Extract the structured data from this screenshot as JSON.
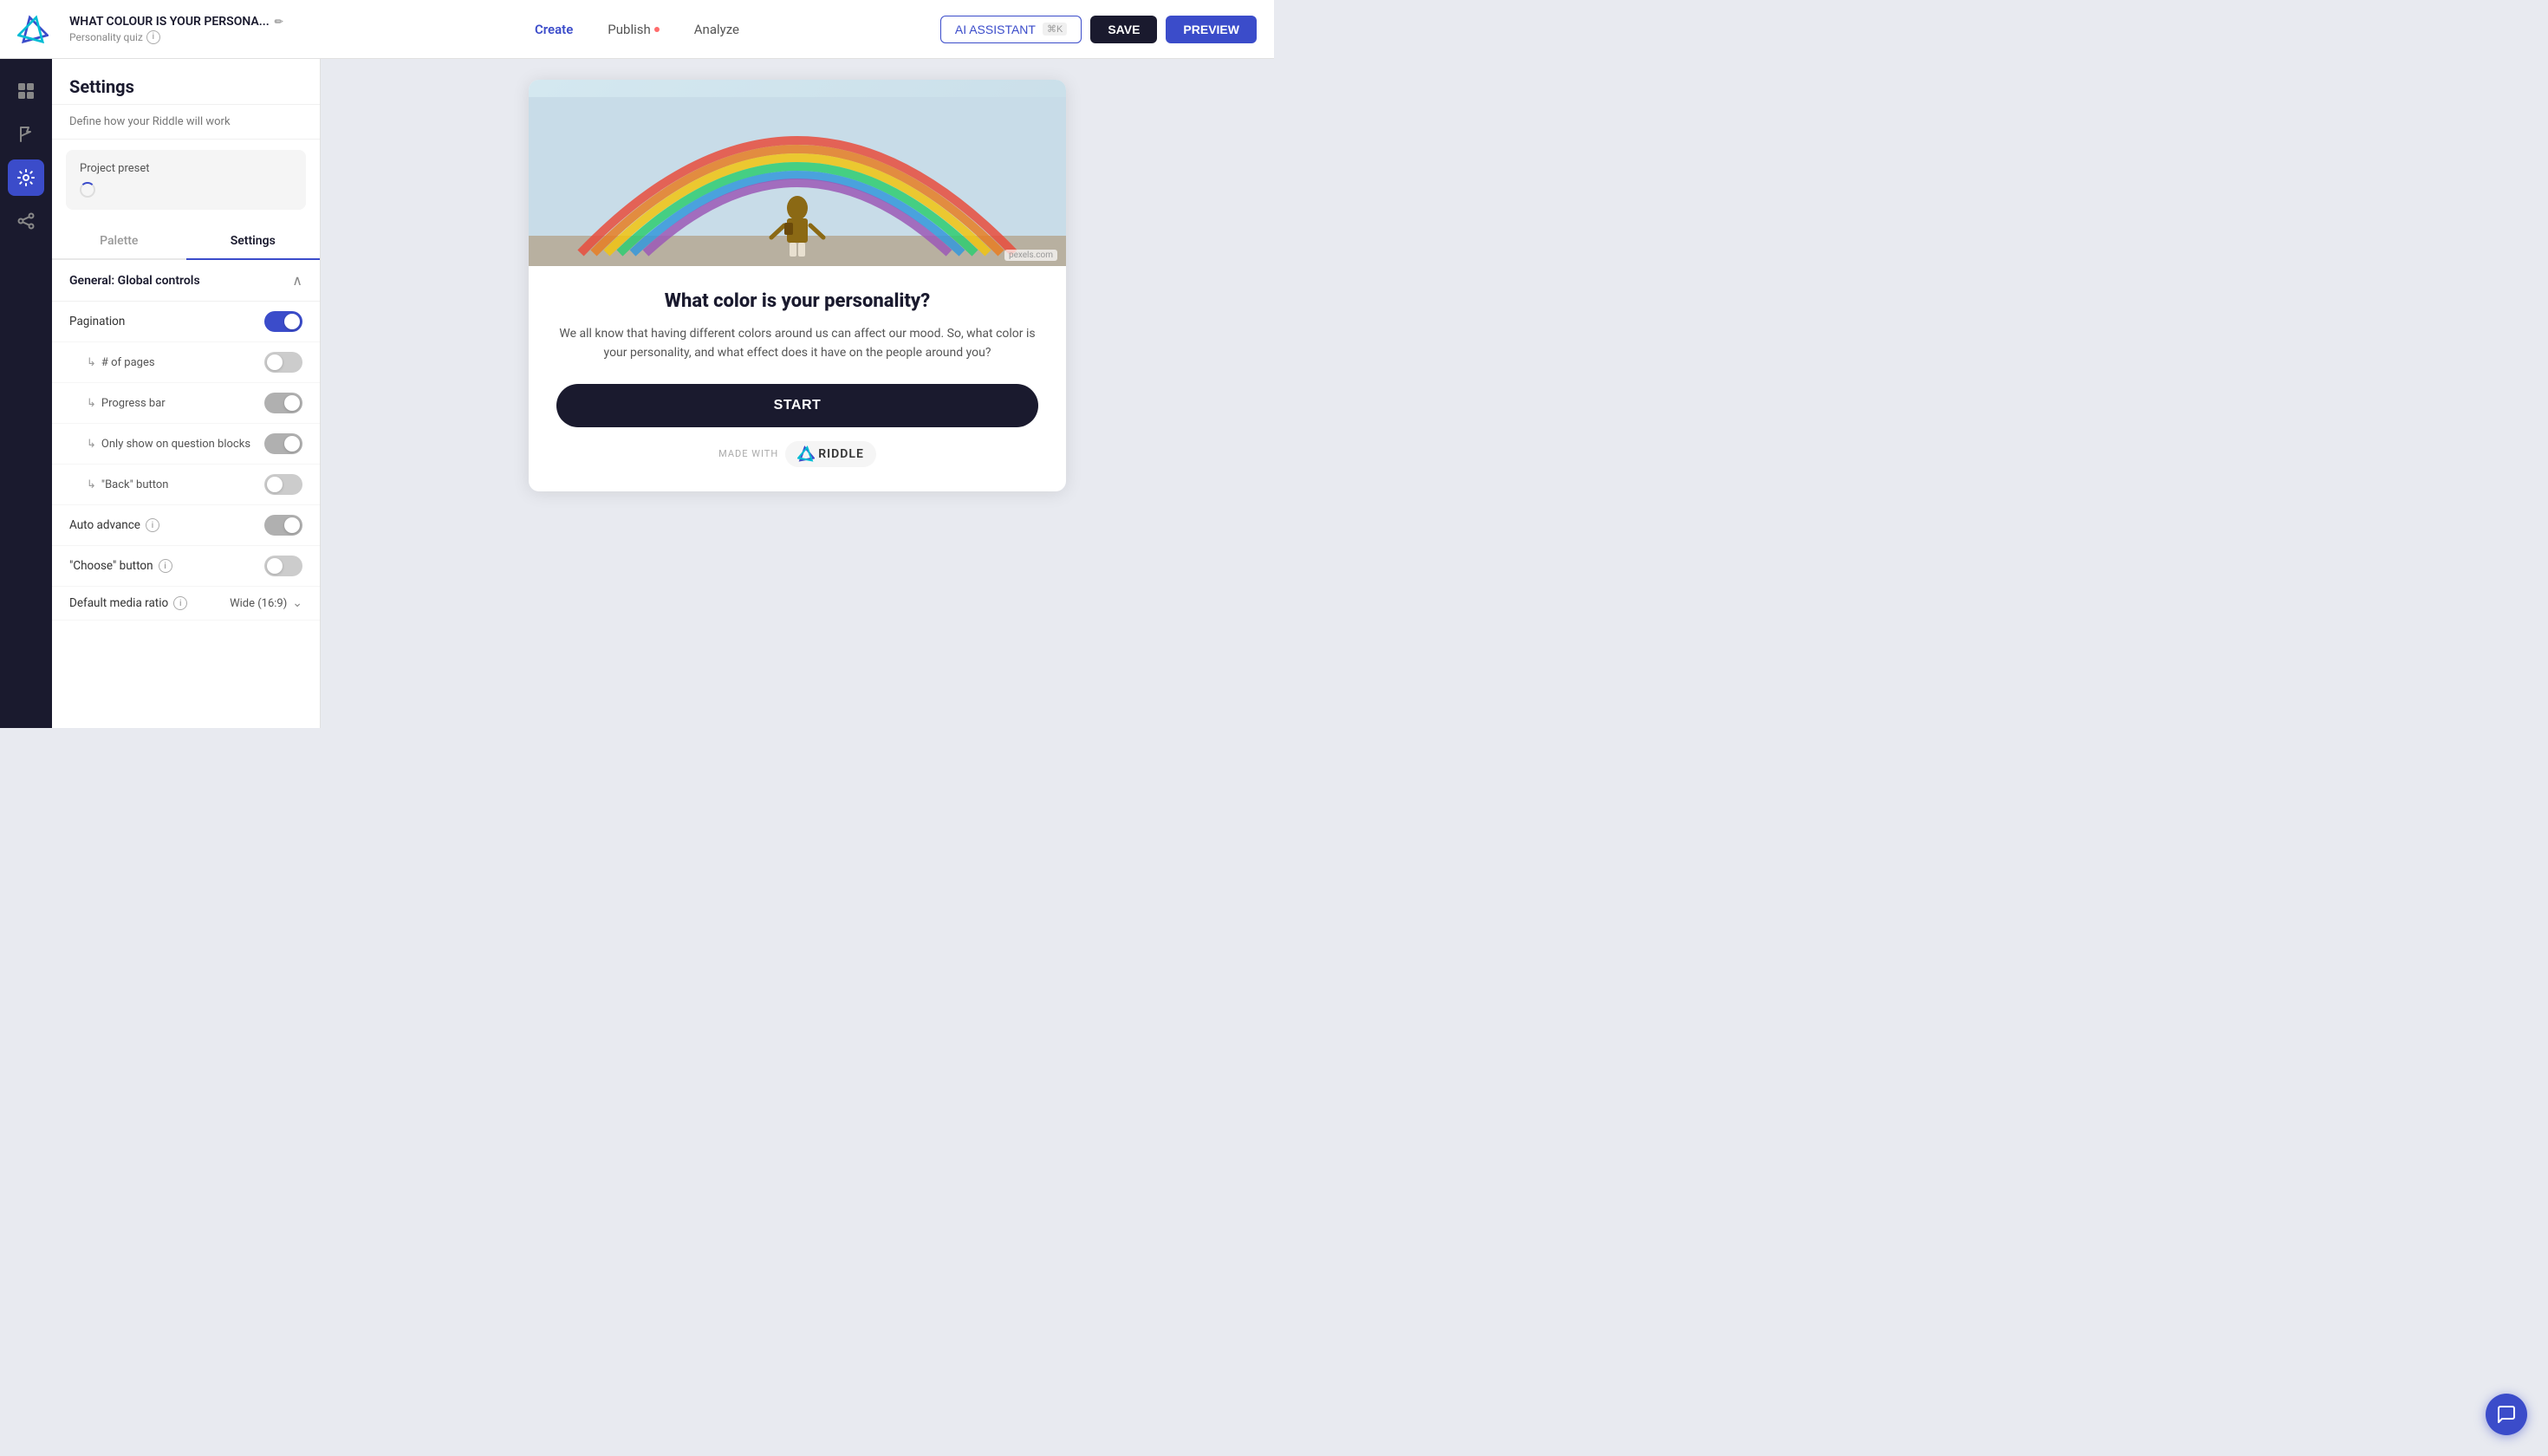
{
  "topnav": {
    "title": "WHAT COLOUR IS YOUR PERSONA...",
    "subtitle": "Personality quiz",
    "nav_create": "Create",
    "nav_publish": "Publish",
    "nav_publish_dot": true,
    "nav_analyze": "Analyze",
    "btn_ai": "AI ASSISTANT",
    "btn_ai_kbd": "⌘K",
    "btn_save": "SAVE",
    "btn_preview": "PREVIEW"
  },
  "settings": {
    "title": "Settings",
    "description": "Define how your Riddle will work",
    "project_preset_label": "Project preset",
    "tab_palette": "Palette",
    "tab_settings": "Settings",
    "section_global": "General: Global controls",
    "pagination_label": "Pagination",
    "pages_label": "# of pages",
    "progress_label": "Progress bar",
    "only_questions_label": "Only show on question blocks",
    "back_button_label": "\"Back\" button",
    "auto_advance_label": "Auto advance",
    "choose_button_label": "\"Choose\" button",
    "default_media_label": "Default media ratio",
    "default_media_value": "Wide (16:9)",
    "pagination_on": true,
    "pages_on": false,
    "progress_on": false,
    "only_questions_on": false,
    "back_button_on": false,
    "auto_advance_on": false,
    "choose_button_on": false
  },
  "preview": {
    "quiz_title": "What color is your personality?",
    "quiz_desc": "We all know that having different colors around us can affect our mood. So, what color is your personality, and what effect does it have on the people around you?",
    "start_btn": "START",
    "made_with": "MADE WITH",
    "riddle_brand": "Riddle",
    "img_credit": "pexels.com"
  }
}
